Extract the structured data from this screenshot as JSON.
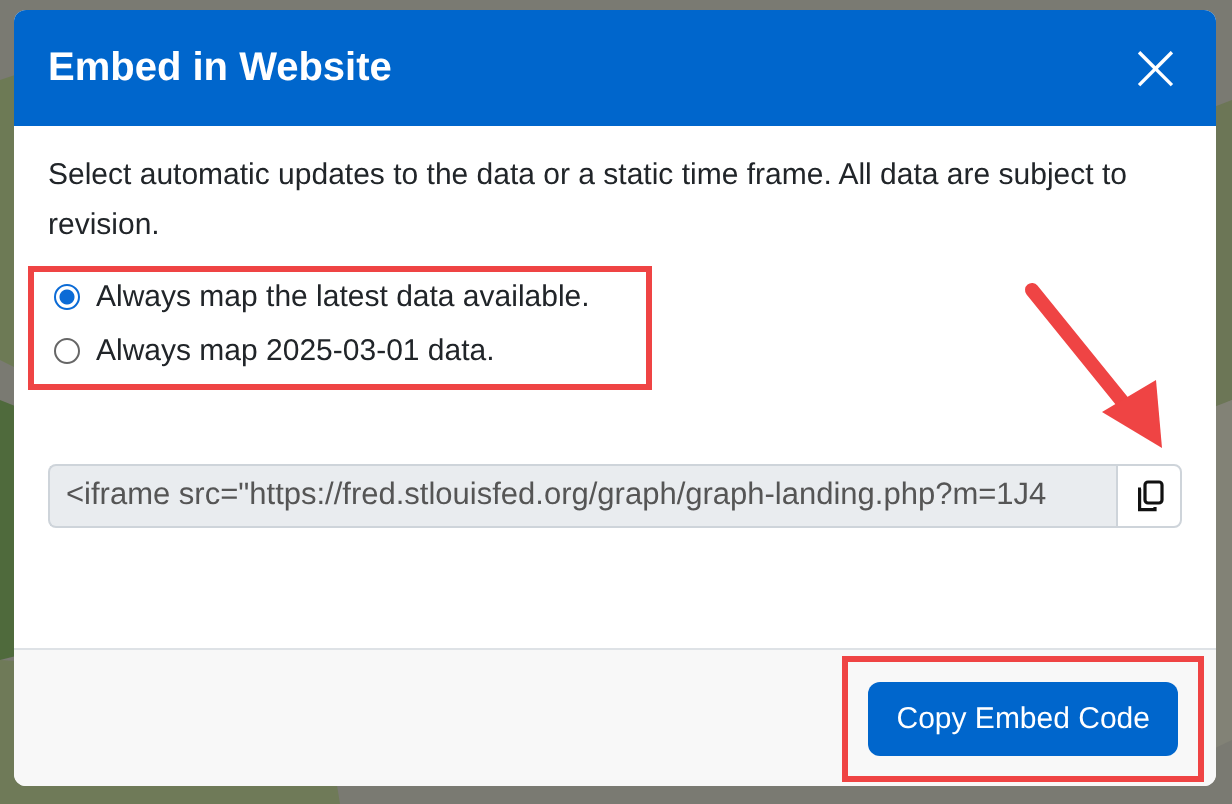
{
  "dialog": {
    "title": "Embed in Website",
    "close_label": "×",
    "description": "Select automatic updates to the data or a static time frame. All data are subject to revision.",
    "options_highlighted": true,
    "options": [
      {
        "label": "Always map the latest data available.",
        "selected": true
      },
      {
        "label": "Always map 2025-03-01 data.",
        "selected": false
      }
    ],
    "embed_code": {
      "value": "<iframe src=\"https://fred.stlouisfed.org/graph/graph-landing.php?m=1J4",
      "copy_pointed": true
    },
    "footer_button": {
      "label": "Copy Embed Code",
      "highlighted": true
    }
  }
}
